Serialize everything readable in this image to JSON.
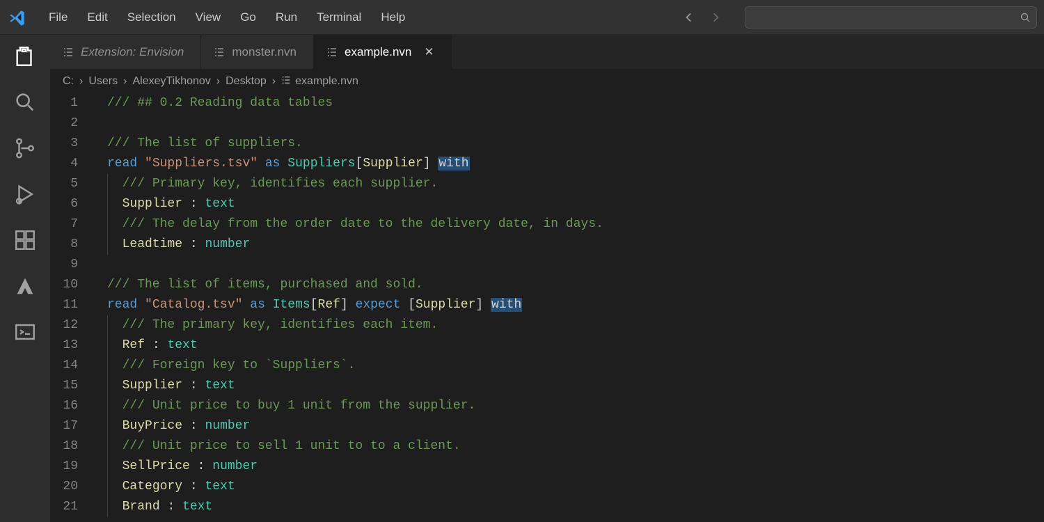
{
  "menu": {
    "items": [
      "File",
      "Edit",
      "Selection",
      "View",
      "Go",
      "Run",
      "Terminal",
      "Help"
    ]
  },
  "activity": {
    "items": [
      {
        "name": "explorer-icon",
        "active": true
      },
      {
        "name": "search-icon",
        "active": false
      },
      {
        "name": "source-control-icon",
        "active": false
      },
      {
        "name": "run-debug-icon",
        "active": false
      },
      {
        "name": "extensions-icon",
        "active": false
      },
      {
        "name": "atlassian-icon",
        "active": false
      },
      {
        "name": "terminal-panel-icon",
        "active": false
      }
    ]
  },
  "tabs": [
    {
      "label": "Extension: Envision",
      "active": false,
      "italic": true,
      "close": false
    },
    {
      "label": "monster.nvn",
      "active": false,
      "italic": false,
      "close": false
    },
    {
      "label": "example.nvn",
      "active": true,
      "italic": false,
      "close": true
    }
  ],
  "breadcrumbs": [
    "C:",
    "Users",
    "AlexeyTikhonov",
    "Desktop",
    "example.nvn"
  ],
  "search": {
    "placeholder": ""
  },
  "code": {
    "lines": [
      {
        "n": 1,
        "indent": 0,
        "tokens": [
          [
            "comment",
            "/// ## 0.2 Reading data tables"
          ]
        ]
      },
      {
        "n": 2,
        "indent": 0,
        "tokens": []
      },
      {
        "n": 3,
        "indent": 0,
        "tokens": [
          [
            "comment",
            "/// The list of suppliers."
          ]
        ]
      },
      {
        "n": 4,
        "indent": 0,
        "tokens": [
          [
            "keyword",
            "read"
          ],
          [
            "white",
            " "
          ],
          [
            "string",
            "\"Suppliers.tsv\""
          ],
          [
            "white",
            " "
          ],
          [
            "keyword",
            "as"
          ],
          [
            "white",
            " "
          ],
          [
            "type",
            "Suppliers"
          ],
          [
            "punct",
            "["
          ],
          [
            "ident",
            "Supplier"
          ],
          [
            "punct",
            "]"
          ],
          [
            "white",
            " "
          ],
          [
            "highlight",
            "with"
          ]
        ]
      },
      {
        "n": 5,
        "indent": 1,
        "tokens": [
          [
            "comment",
            "/// Primary key, identifies each supplier."
          ]
        ]
      },
      {
        "n": 6,
        "indent": 1,
        "tokens": [
          [
            "field",
            "Supplier"
          ],
          [
            "white",
            " "
          ],
          [
            "punct",
            ":"
          ],
          [
            "white",
            " "
          ],
          [
            "type",
            "text"
          ]
        ]
      },
      {
        "n": 7,
        "indent": 1,
        "tokens": [
          [
            "comment",
            "/// The delay from the order date to the delivery date, in days."
          ]
        ]
      },
      {
        "n": 8,
        "indent": 1,
        "tokens": [
          [
            "field",
            "Leadtime"
          ],
          [
            "white",
            " "
          ],
          [
            "punct",
            ":"
          ],
          [
            "white",
            " "
          ],
          [
            "type",
            "number"
          ]
        ]
      },
      {
        "n": 9,
        "indent": 0,
        "tokens": []
      },
      {
        "n": 10,
        "indent": 0,
        "tokens": [
          [
            "comment",
            "/// The list of items, purchased and sold."
          ]
        ]
      },
      {
        "n": 11,
        "indent": 0,
        "tokens": [
          [
            "keyword",
            "read"
          ],
          [
            "white",
            " "
          ],
          [
            "string",
            "\"Catalog.tsv\""
          ],
          [
            "white",
            " "
          ],
          [
            "keyword",
            "as"
          ],
          [
            "white",
            " "
          ],
          [
            "type",
            "Items"
          ],
          [
            "punct",
            "["
          ],
          [
            "ident",
            "Ref"
          ],
          [
            "punct",
            "]"
          ],
          [
            "white",
            " "
          ],
          [
            "keyword",
            "expect"
          ],
          [
            "white",
            " "
          ],
          [
            "punct",
            "["
          ],
          [
            "ident",
            "Supplier"
          ],
          [
            "punct",
            "]"
          ],
          [
            "white",
            " "
          ],
          [
            "highlight",
            "with"
          ]
        ]
      },
      {
        "n": 12,
        "indent": 1,
        "tokens": [
          [
            "comment",
            "/// The primary key, identifies each item."
          ]
        ]
      },
      {
        "n": 13,
        "indent": 1,
        "tokens": [
          [
            "field",
            "Ref"
          ],
          [
            "white",
            " "
          ],
          [
            "punct",
            ":"
          ],
          [
            "white",
            " "
          ],
          [
            "type",
            "text"
          ]
        ]
      },
      {
        "n": 14,
        "indent": 1,
        "tokens": [
          [
            "comment",
            "/// Foreign key to `Suppliers`."
          ]
        ]
      },
      {
        "n": 15,
        "indent": 1,
        "tokens": [
          [
            "field",
            "Supplier"
          ],
          [
            "white",
            " "
          ],
          [
            "punct",
            ":"
          ],
          [
            "white",
            " "
          ],
          [
            "type",
            "text"
          ]
        ]
      },
      {
        "n": 16,
        "indent": 1,
        "tokens": [
          [
            "comment",
            "/// Unit price to buy 1 unit from the supplier."
          ]
        ]
      },
      {
        "n": 17,
        "indent": 1,
        "tokens": [
          [
            "field",
            "BuyPrice"
          ],
          [
            "white",
            " "
          ],
          [
            "punct",
            ":"
          ],
          [
            "white",
            " "
          ],
          [
            "type",
            "number"
          ]
        ]
      },
      {
        "n": 18,
        "indent": 1,
        "tokens": [
          [
            "comment",
            "/// Unit price to sell 1 unit to to a client."
          ]
        ]
      },
      {
        "n": 19,
        "indent": 1,
        "tokens": [
          [
            "field",
            "SellPrice"
          ],
          [
            "white",
            " "
          ],
          [
            "punct",
            ":"
          ],
          [
            "white",
            " "
          ],
          [
            "type",
            "number"
          ]
        ]
      },
      {
        "n": 20,
        "indent": 1,
        "tokens": [
          [
            "field",
            "Category"
          ],
          [
            "white",
            " "
          ],
          [
            "punct",
            ":"
          ],
          [
            "white",
            " "
          ],
          [
            "type",
            "text"
          ]
        ]
      },
      {
        "n": 21,
        "indent": 1,
        "tokens": [
          [
            "field",
            "Brand"
          ],
          [
            "white",
            " "
          ],
          [
            "punct",
            ":"
          ],
          [
            "white",
            " "
          ],
          [
            "type",
            "text"
          ]
        ]
      }
    ]
  }
}
